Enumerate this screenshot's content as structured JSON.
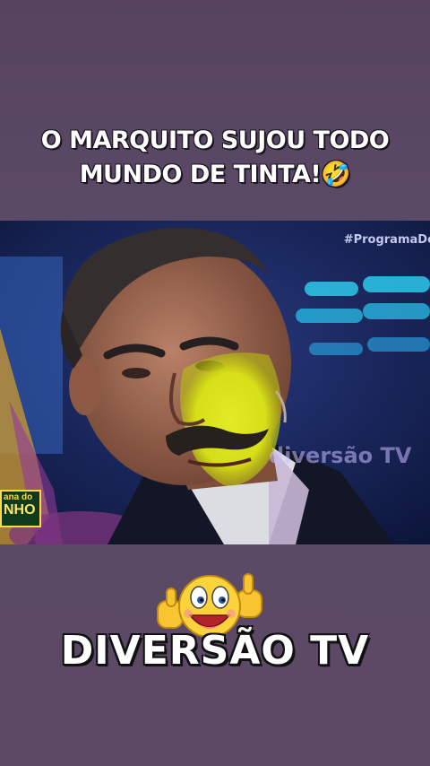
{
  "caption": {
    "line1": "O MARQUITO SUJOU TODO",
    "line2": "MUNDO DE TINTA!🤣"
  },
  "video": {
    "hashtag": "#ProgramaDo",
    "watermark": "diversão TV",
    "logo_top": "ana do",
    "logo_big": "NHO"
  },
  "brand": {
    "name": "DIVERSÃO TV",
    "sticker_icon": "thumbs-up-smiley-icon"
  }
}
